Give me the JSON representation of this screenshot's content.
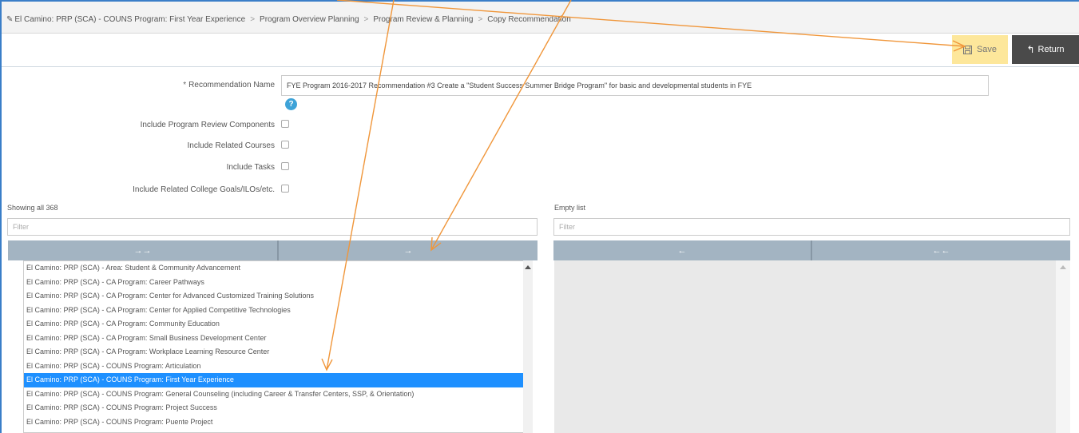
{
  "breadcrumb": {
    "items": [
      "El Camino: PRP (SCA) - COUNS Program: First Year Experience",
      "Program Overview Planning",
      "Program Review & Planning",
      "Copy Recommendation"
    ],
    "separator": ">"
  },
  "toolbar": {
    "save_label": "Save",
    "return_label": "Return"
  },
  "form": {
    "recommendation_name_label": "Recommendation Name",
    "required_marker": "*",
    "recommendation_name_value": "FYE Program 2016-2017 Recommendation #3 Create a \"Student Success Summer Bridge Program\" for basic and developmental students in FYE",
    "help_glyph": "?",
    "checkboxes": [
      {
        "label": "Include Program Review Components",
        "checked": false
      },
      {
        "label": "Include Related Courses",
        "checked": false
      },
      {
        "label": "Include Tasks",
        "checked": false
      },
      {
        "label": "Include Related College Goals/ILOs/etc.",
        "checked": false
      }
    ]
  },
  "left_list": {
    "caption": "Showing all 368",
    "filter_placeholder": "Filter",
    "move_all_glyph": "→→",
    "move_selected_glyph": "→",
    "items": [
      "El Camino: PRP (SCA) - Area: Student & Community Advancement",
      "El Camino: PRP (SCA) - CA Program: Career Pathways",
      "El Camino: PRP (SCA) - CA Program: Center for Advanced Customized Training Solutions",
      "El Camino: PRP (SCA) - CA Program: Center for Applied Competitive Technologies",
      "El Camino: PRP (SCA) - CA Program: Community Education",
      "El Camino: PRP (SCA) - CA Program: Small Business Development Center",
      "El Camino: PRP (SCA) - CA Program: Workplace Learning Resource Center",
      "El Camino: PRP (SCA) - COUNS Program: Articulation",
      "El Camino: PRP (SCA) - COUNS Program: First Year Experience",
      "El Camino: PRP (SCA) - COUNS Program: General Counseling (including Career & Transfer Centers, SSP, & Orientation)",
      "El Camino: PRP (SCA) - COUNS Program: Project Success",
      "El Camino: PRP (SCA) - COUNS Program: Puente Project"
    ],
    "selected_index": 8
  },
  "right_list": {
    "caption": "Empty list",
    "filter_placeholder": "Filter",
    "remove_selected_glyph": "←",
    "remove_all_glyph": "←←",
    "items": []
  },
  "colors": {
    "save_bg": "#fde79b",
    "return_bg": "#4a4a4a",
    "selected_bg": "#1e90ff",
    "move_btn_bg": "#a3b4c2",
    "annotation_arrow": "#f0963a"
  }
}
